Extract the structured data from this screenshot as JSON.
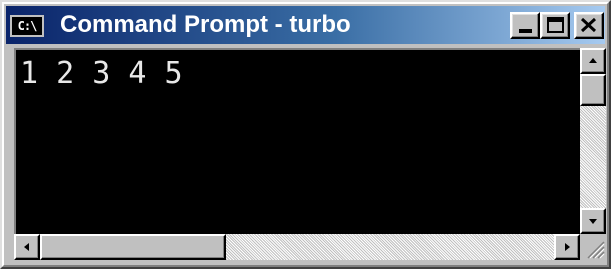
{
  "window": {
    "title": "Command Prompt - turbo",
    "icon": "console-icon",
    "icon_text": "C:\\"
  },
  "titlebar_buttons": {
    "minimize": "minimize-icon",
    "maximize": "maximize-icon",
    "close": "close-icon"
  },
  "console": {
    "output": "1 2 3 4 5",
    "background": "#000000",
    "foreground": "#e8e8e8"
  },
  "scrollbars": {
    "vertical": {
      "position": 0.0
    },
    "horizontal": {
      "position": 0.0
    }
  },
  "colors": {
    "titlebar_start": "#0a246a",
    "titlebar_end": "#a6caf0",
    "chrome": "#c0c0c0"
  }
}
